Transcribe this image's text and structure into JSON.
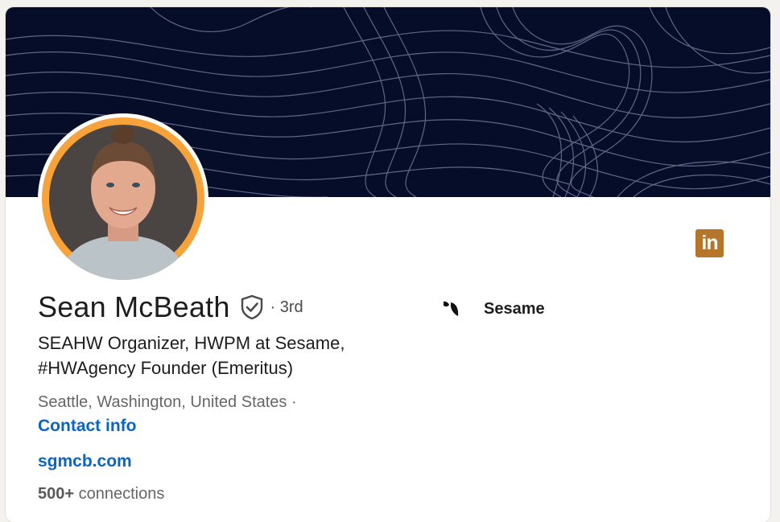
{
  "profile": {
    "name": "Sean McBeath",
    "degree": "· 3rd",
    "headline": "SEAHW Organizer, HWPM at Sesame, #HWAgency Founder (Emeritus)",
    "location": "Seattle, Washington, United States ·",
    "contact_label": "Contact info",
    "website": "sgmcb.com",
    "connections_count": "500+",
    "connections_label": "connections"
  },
  "company": {
    "name": "Sesame",
    "logo_icon": "sesame-logo-icon"
  },
  "brand_badge": {
    "label": "in",
    "icon": "linkedin-icon",
    "color": "#b5762a"
  },
  "colors": {
    "banner": "#060d28",
    "avatar_ring": "#f8a23b",
    "link": "#0a66c2"
  },
  "icons": {
    "verified": "verified-shield-icon"
  }
}
